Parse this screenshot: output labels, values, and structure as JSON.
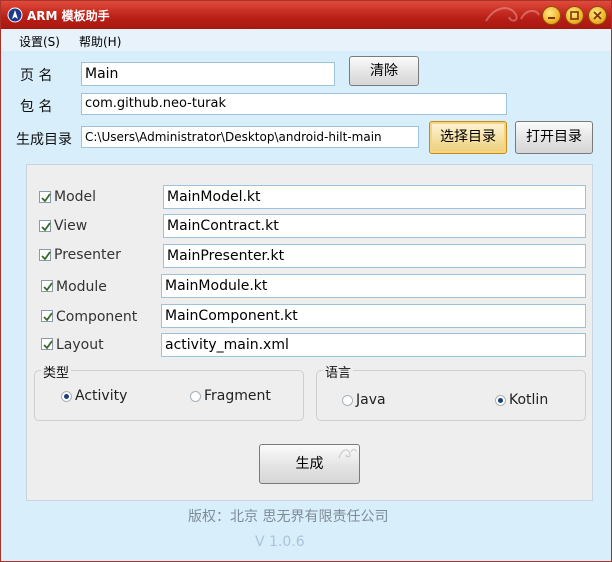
{
  "window": {
    "title": "ARM 模板助手",
    "accent": "#b81f17"
  },
  "menu": {
    "settings": "设置(S)",
    "help": "帮助(H)"
  },
  "form": {
    "page_label": "页     名",
    "page_value": "Main",
    "clear_button": "清除",
    "package_label": "包     名",
    "package_value": "com.github.neo-turak",
    "dir_label": "生成目录",
    "dir_value": "C:\\Users\\Administrator\\Desktop\\android-hilt-main",
    "choose_dir_button": "选择目录",
    "open_dir_button": "打开目录"
  },
  "files": [
    {
      "label": "Model",
      "value": "MainModel.kt",
      "checked": true
    },
    {
      "label": "View",
      "value": "MainContract.kt",
      "checked": true
    },
    {
      "label": "Presenter",
      "value": "MainPresenter.kt",
      "checked": true
    },
    {
      "label": "Module",
      "value": "MainModule.kt",
      "checked": true
    },
    {
      "label": "Component",
      "value": "MainComponent.kt",
      "checked": true
    },
    {
      "label": "Layout",
      "value": "activity_main.xml",
      "checked": true
    }
  ],
  "type_group": {
    "title": "类型",
    "options": [
      {
        "label": "Activity",
        "selected": true
      },
      {
        "label": "Fragment",
        "selected": false
      }
    ]
  },
  "language_group": {
    "title": "语言",
    "options": [
      {
        "label": "Java",
        "selected": false
      },
      {
        "label": "Kotlin",
        "selected": true
      }
    ]
  },
  "generate_button": "生成",
  "footer": {
    "copyright": "版权：北京 思无界有限责任公司",
    "version": "V 1.0.6"
  }
}
